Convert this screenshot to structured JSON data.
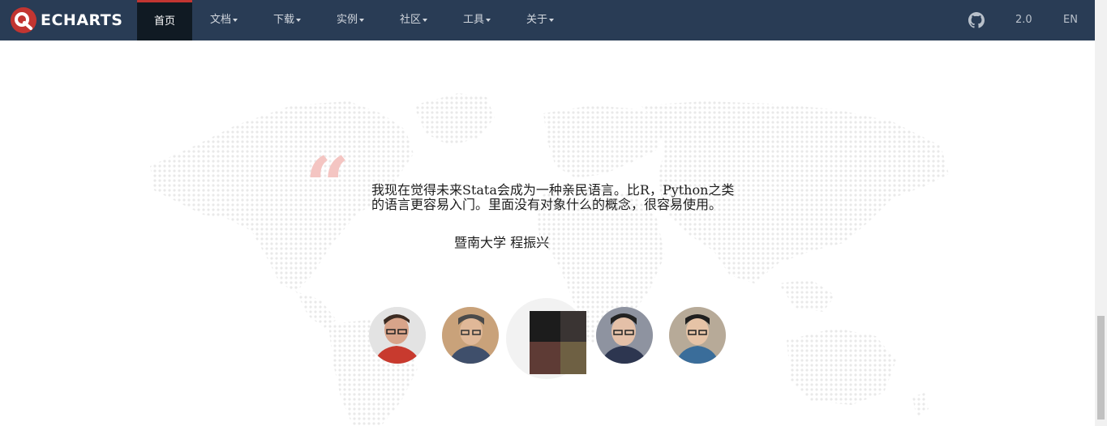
{
  "navbar": {
    "brand": "ECHARTS",
    "items": [
      {
        "label": "首页",
        "active": true
      },
      {
        "label": "文档",
        "dropdown": true
      },
      {
        "label": "下载",
        "dropdown": true
      },
      {
        "label": "实例",
        "dropdown": true
      },
      {
        "label": "社区",
        "dropdown": true
      },
      {
        "label": "工具",
        "dropdown": true
      },
      {
        "label": "关于",
        "dropdown": true
      }
    ],
    "version": "2.0",
    "language": "EN",
    "github_icon": "github-icon",
    "background_color": "#293c55",
    "active_color": "#101a23",
    "accent_color": "#c23531"
  },
  "testimonial": {
    "quote_mark": "“",
    "text_line_1": "我现在觉得未来Stata会成为一种亲民语言。比R，Python之类",
    "text_line_2": "的语言更容易入门。里面没有对象什么的概念，很容易使用。",
    "author": "暨南大学 程振兴"
  },
  "avatars": [
    {
      "name": "avatar-1",
      "selected": false
    },
    {
      "name": "avatar-2",
      "selected": false
    },
    {
      "name": "avatar-3",
      "selected": true
    },
    {
      "name": "avatar-4",
      "selected": false
    },
    {
      "name": "avatar-5",
      "selected": false
    }
  ]
}
